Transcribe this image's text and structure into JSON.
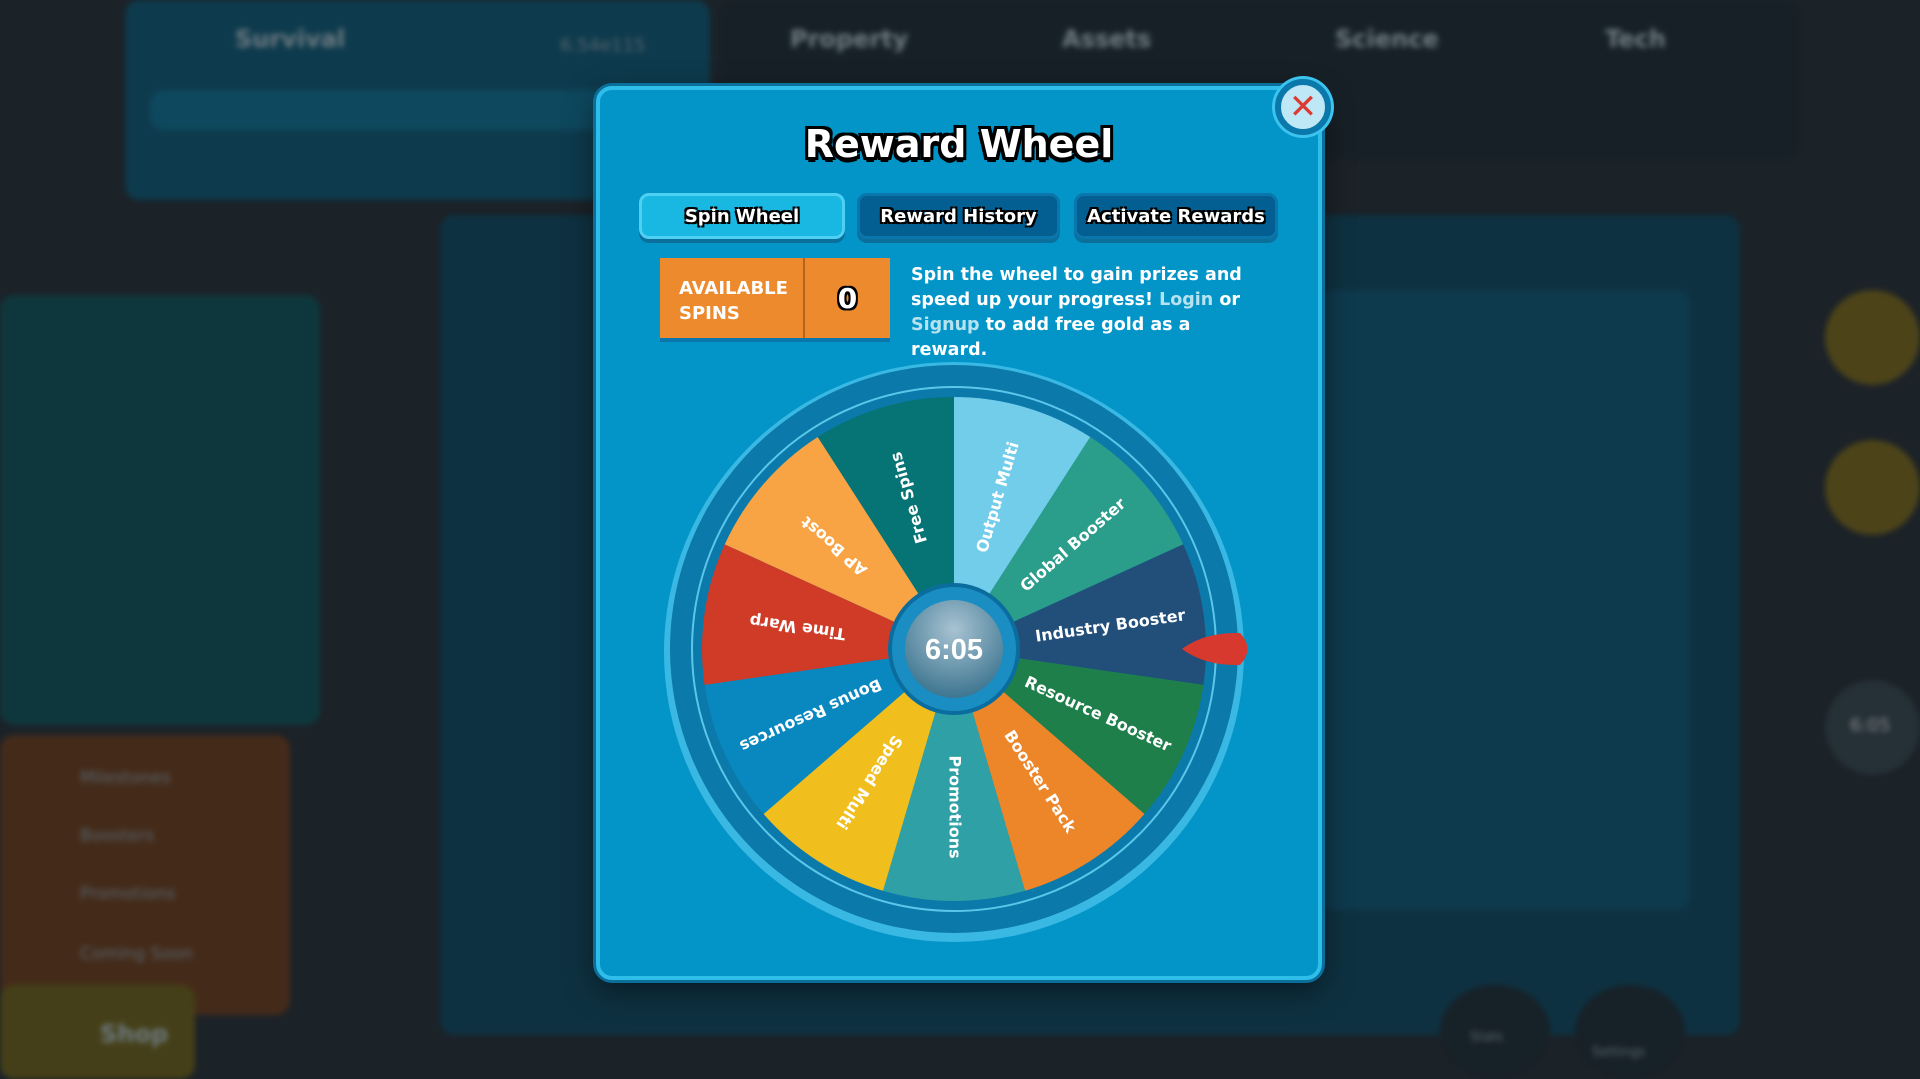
{
  "background": {
    "top_tabs": [
      "Survival",
      "Property",
      "Assets",
      "Science",
      "Tech"
    ],
    "survival_value": "6.54e115",
    "side_menu": [
      "Milestones",
      "Boosters",
      "Promotions",
      "Coming Soon"
    ],
    "shop_label": "Shop",
    "bottom_buttons": [
      "Stats",
      "Settings"
    ],
    "mini_wheel_timer": "6:05"
  },
  "modal": {
    "title": "Reward Wheel",
    "close_icon": "close-x-icon",
    "tabs": [
      {
        "label": "Spin Wheel",
        "active": true
      },
      {
        "label": "Reward History",
        "active": false
      },
      {
        "label": "Activate Rewards",
        "active": false
      }
    ],
    "available_spins": {
      "label": "AVAILABLE SPINS",
      "value": "0"
    },
    "info": {
      "part1": "Spin the wheel to gain prizes and speed up your progress! ",
      "login": "Login",
      "part2": " or ",
      "signup": "Signup",
      "part3": " to add free gold as a reward."
    },
    "wheel": {
      "timer": "6:05",
      "segments": [
        {
          "label": "Output Multi",
          "color": "#72cdea"
        },
        {
          "label": "Global Booster",
          "color": "#2a9d8b"
        },
        {
          "label": "Industry Booster",
          "color": "#214f7a"
        },
        {
          "label": "Resource Booster",
          "color": "#1f7f4a"
        },
        {
          "label": "Booster Pack",
          "color": "#ec8629"
        },
        {
          "label": "Promotions",
          "color": "#2ea0a6"
        },
        {
          "label": "Speed Multi",
          "color": "#f0be1d"
        },
        {
          "label": "Bonus Resources",
          "color": "#0987bf"
        },
        {
          "label": "Time Warp",
          "color": "#cf3b27"
        },
        {
          "label": "AP Boost",
          "color": "#f8a445"
        },
        {
          "label": "Free Spins",
          "color": "#067474"
        }
      ],
      "pointer_color": "#d8392e"
    }
  }
}
